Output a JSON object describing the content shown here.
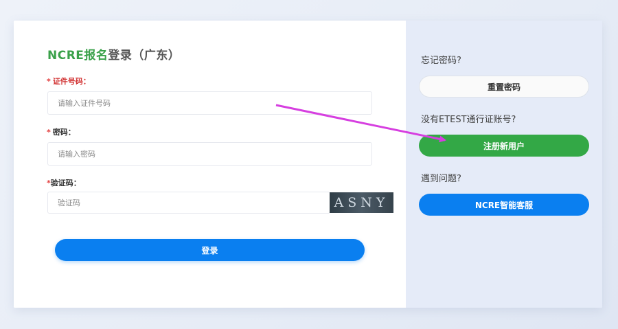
{
  "login": {
    "title_highlight": "NCRE报名",
    "title_rest": "登录（广东）",
    "fields": [
      {
        "label": "证件号码：",
        "placeholder": "请输入证件号码"
      },
      {
        "label": "密码：",
        "placeholder": "请输入密码"
      },
      {
        "label": "验证码：",
        "placeholder": "验证码"
      }
    ],
    "captcha_text": "ASNY",
    "login_button": "登录"
  },
  "side": {
    "forgot_text": "忘记密码?",
    "reset_button": "重置密码",
    "no_account_text": "没有ETEST通行证账号?",
    "register_button": "注册新用户",
    "problem_text": "遇到问题?",
    "service_button": "NCRE智能客服"
  },
  "colors": {
    "accent_green": "#33a846",
    "accent_blue": "#0a7ff0",
    "annotation_arrow": "#d63fe0"
  }
}
